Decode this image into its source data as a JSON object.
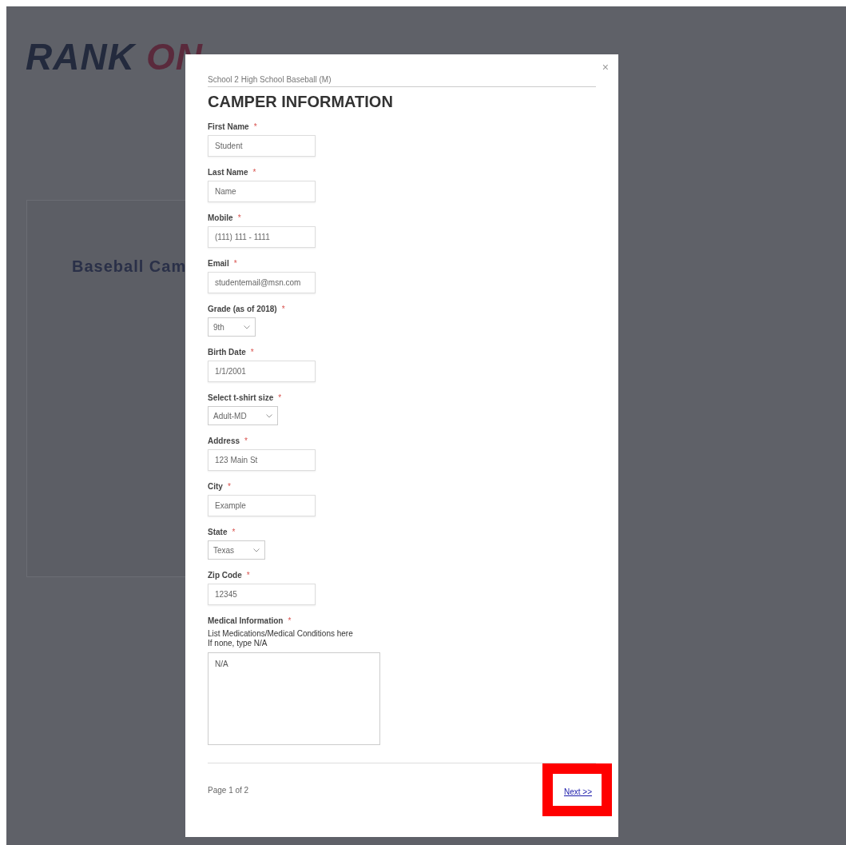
{
  "background": {
    "logo": {
      "part_1": "RANK",
      "part_2": "ON"
    },
    "heading": "Baseball Cam"
  },
  "modal": {
    "subtitle": "School 2 High School Baseball (M)",
    "title": "CAMPER INFORMATION",
    "close": "×",
    "required_mark": "*",
    "fields": [
      {
        "kind": "input",
        "label": "First Name",
        "required": true,
        "value": "Student"
      },
      {
        "kind": "input",
        "label": "Last Name",
        "required": true,
        "value": "Name"
      },
      {
        "kind": "input",
        "label": "Mobile",
        "required": true,
        "value": "(111) 111 - 1111"
      },
      {
        "kind": "input",
        "label": "Email",
        "required": true,
        "value": "studentemail@msn.com"
      },
      {
        "kind": "select",
        "label": "Grade (as of 2018)",
        "required": true,
        "value": "9th"
      },
      {
        "kind": "input",
        "label": "Birth Date",
        "required": true,
        "value": "1/1/2001"
      },
      {
        "kind": "select",
        "label": "Select t-shirt size",
        "required": true,
        "value": "Adult-MD"
      },
      {
        "kind": "input",
        "label": "Address",
        "required": true,
        "value": "123 Main St"
      },
      {
        "kind": "input",
        "label": "City",
        "required": true,
        "value": "Example"
      },
      {
        "kind": "select",
        "label": "State",
        "required": true,
        "value": "Texas"
      },
      {
        "kind": "input",
        "label": "Zip Code",
        "required": true,
        "value": "12345"
      },
      {
        "kind": "textarea",
        "label": "Medical Information",
        "required": true,
        "hint": [
          "List Medications/Medical Conditions here",
          "If none, type N/A"
        ],
        "value": "N/A"
      }
    ],
    "footer": {
      "page": "Page 1 of 2",
      "next": "Next >>",
      "highlighted": true
    }
  }
}
